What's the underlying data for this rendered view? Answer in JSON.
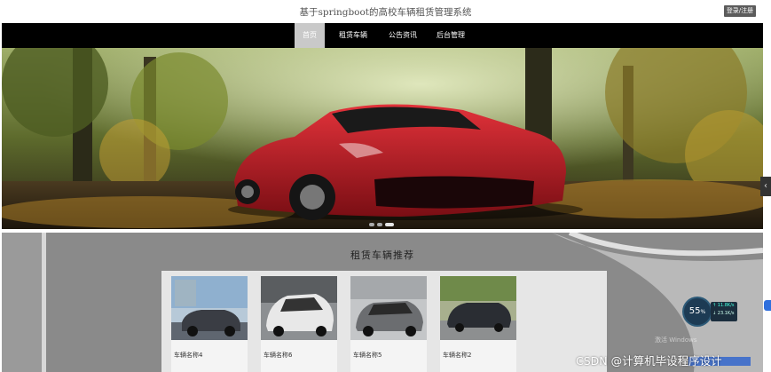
{
  "header": {
    "site_title": "基于springboot的高校车辆租赁管理系统",
    "login_label": "登录/注册"
  },
  "nav": {
    "items": [
      {
        "label": "首页",
        "active": true
      },
      {
        "label": "租赁车辆",
        "active": false
      },
      {
        "label": "公告资讯",
        "active": false
      },
      {
        "label": "后台管理",
        "active": false
      }
    ]
  },
  "carousel": {
    "slide_count": 3,
    "active_slide": 2
  },
  "recommend": {
    "title": "租赁车辆推荐",
    "cars": [
      {
        "name": "车辆名称4",
        "color": "#3a3d44"
      },
      {
        "name": "车辆名称6",
        "color": "#e8e8e8"
      },
      {
        "name": "车辆名称5",
        "color": "#6b6d70"
      },
      {
        "name": "车辆名称2",
        "color": "#2a2d33"
      }
    ]
  },
  "widget": {
    "percent": "55",
    "unit": "%",
    "up_rate": "11.8K/s",
    "down_rate": "23.1K/s"
  },
  "overlay": {
    "activation_text": "激活 Windows",
    "watermark": "CSDN @计算机毕设程序设计"
  },
  "colors": {
    "nav_bg": "#000000",
    "nav_active": "#c9c9c9",
    "car_red": "#b51c24",
    "section_bg": "#8a8a8a"
  }
}
